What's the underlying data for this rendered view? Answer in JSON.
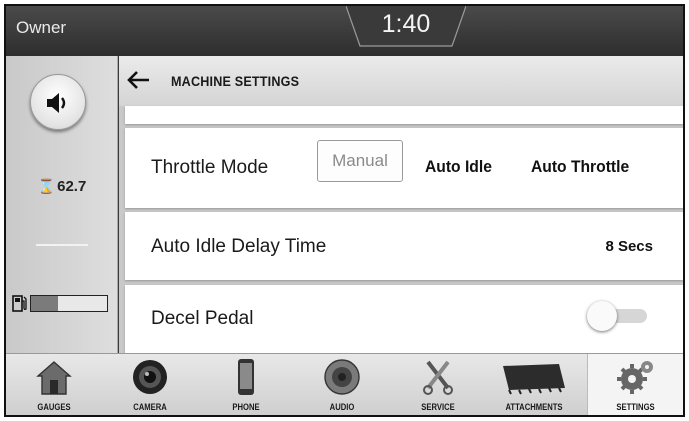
{
  "status": {
    "user": "Owner",
    "time": "1:40"
  },
  "rail": {
    "volume_icon": "speaker-icon",
    "hours_icon": "hourglass-icon",
    "hours_value": "62.7",
    "fuel_icon": "fuel-pump-icon",
    "fuel_level": 0.35
  },
  "header": {
    "back_icon": "back-arrow-icon",
    "title": "MACHINE SETTINGS"
  },
  "settings": {
    "throttle_mode": {
      "label": "Throttle Mode",
      "options": [
        "Manual",
        "Auto Idle",
        "Auto Throttle"
      ],
      "selected": "Manual"
    },
    "auto_idle_delay": {
      "label": "Auto Idle Delay Time",
      "value": "8 Secs"
    },
    "decel_pedal": {
      "label": "Decel Pedal",
      "enabled": false
    }
  },
  "nav": {
    "items": [
      {
        "label": "GAUGES",
        "icon": "house-icon"
      },
      {
        "label": "CAMERA",
        "icon": "camera-lens-icon"
      },
      {
        "label": "PHONE",
        "icon": "phone-icon"
      },
      {
        "label": "AUDIO",
        "icon": "speaker-icon"
      },
      {
        "label": "SERVICE",
        "icon": "wrench-icon"
      },
      {
        "label": "ATTACHMENTS",
        "icon": "bucket-icon"
      },
      {
        "label": "SETTINGS",
        "icon": "gears-icon"
      }
    ],
    "active": "SETTINGS"
  }
}
